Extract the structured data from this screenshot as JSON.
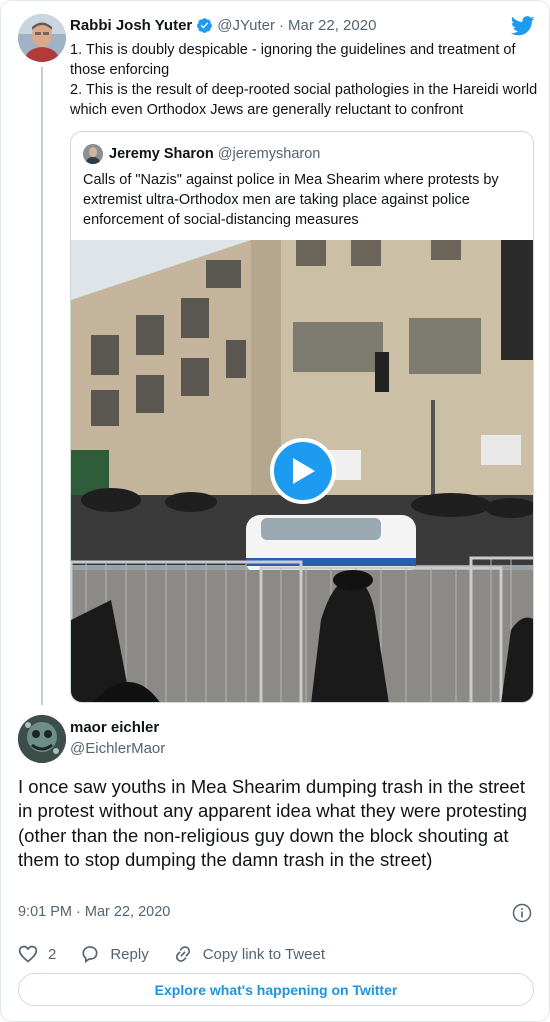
{
  "parent_tweet": {
    "author_name": "Rabbi Josh Yuter",
    "handle": "@JYuter",
    "separator": "·",
    "date": "Mar 22, 2020",
    "text_line1": "1. This is doubly despicable - ignoring the guidelines and treatment of those enforcing",
    "text_line2": "2. This is the result of deep-rooted social pathologies in the Hareidi world which even Orthodox Jews are generally reluctant to confront",
    "icons": [
      "avatar",
      "verified-badge",
      "twitter-bird-logo"
    ]
  },
  "quoted_tweet": {
    "author_name": "Jeremy Sharon",
    "handle": "@jeremysharon",
    "text": "Calls of \"Nazis\" against police in Mea Shearim where protests by extremist ultra-Orthodox men are taking place against police enforcement of social-distancing measures",
    "media_type": "video",
    "icons": [
      "play-icon"
    ]
  },
  "main_tweet": {
    "author_name": "maor eichler",
    "handle": "@EichlerMaor",
    "text": "I once saw youths in Mea Shearim dumping trash in the street in protest without any apparent idea what they were protesting (other than the non-religious guy down the block shouting at them to stop dumping the damn trash in the street)",
    "time": "9:01 PM",
    "separator": "·",
    "date": "Mar 22, 2020"
  },
  "actions": {
    "like_count": "2",
    "reply_label": "Reply",
    "copy_link_label": "Copy link to Tweet"
  },
  "footer": {
    "explore_label": "Explore what's happening on Twitter"
  },
  "colors": {
    "twitter_blue": "#1d9bf0",
    "link_blue": "#1b95e0",
    "secondary_text": "#536471",
    "border": "#cfd9de"
  }
}
